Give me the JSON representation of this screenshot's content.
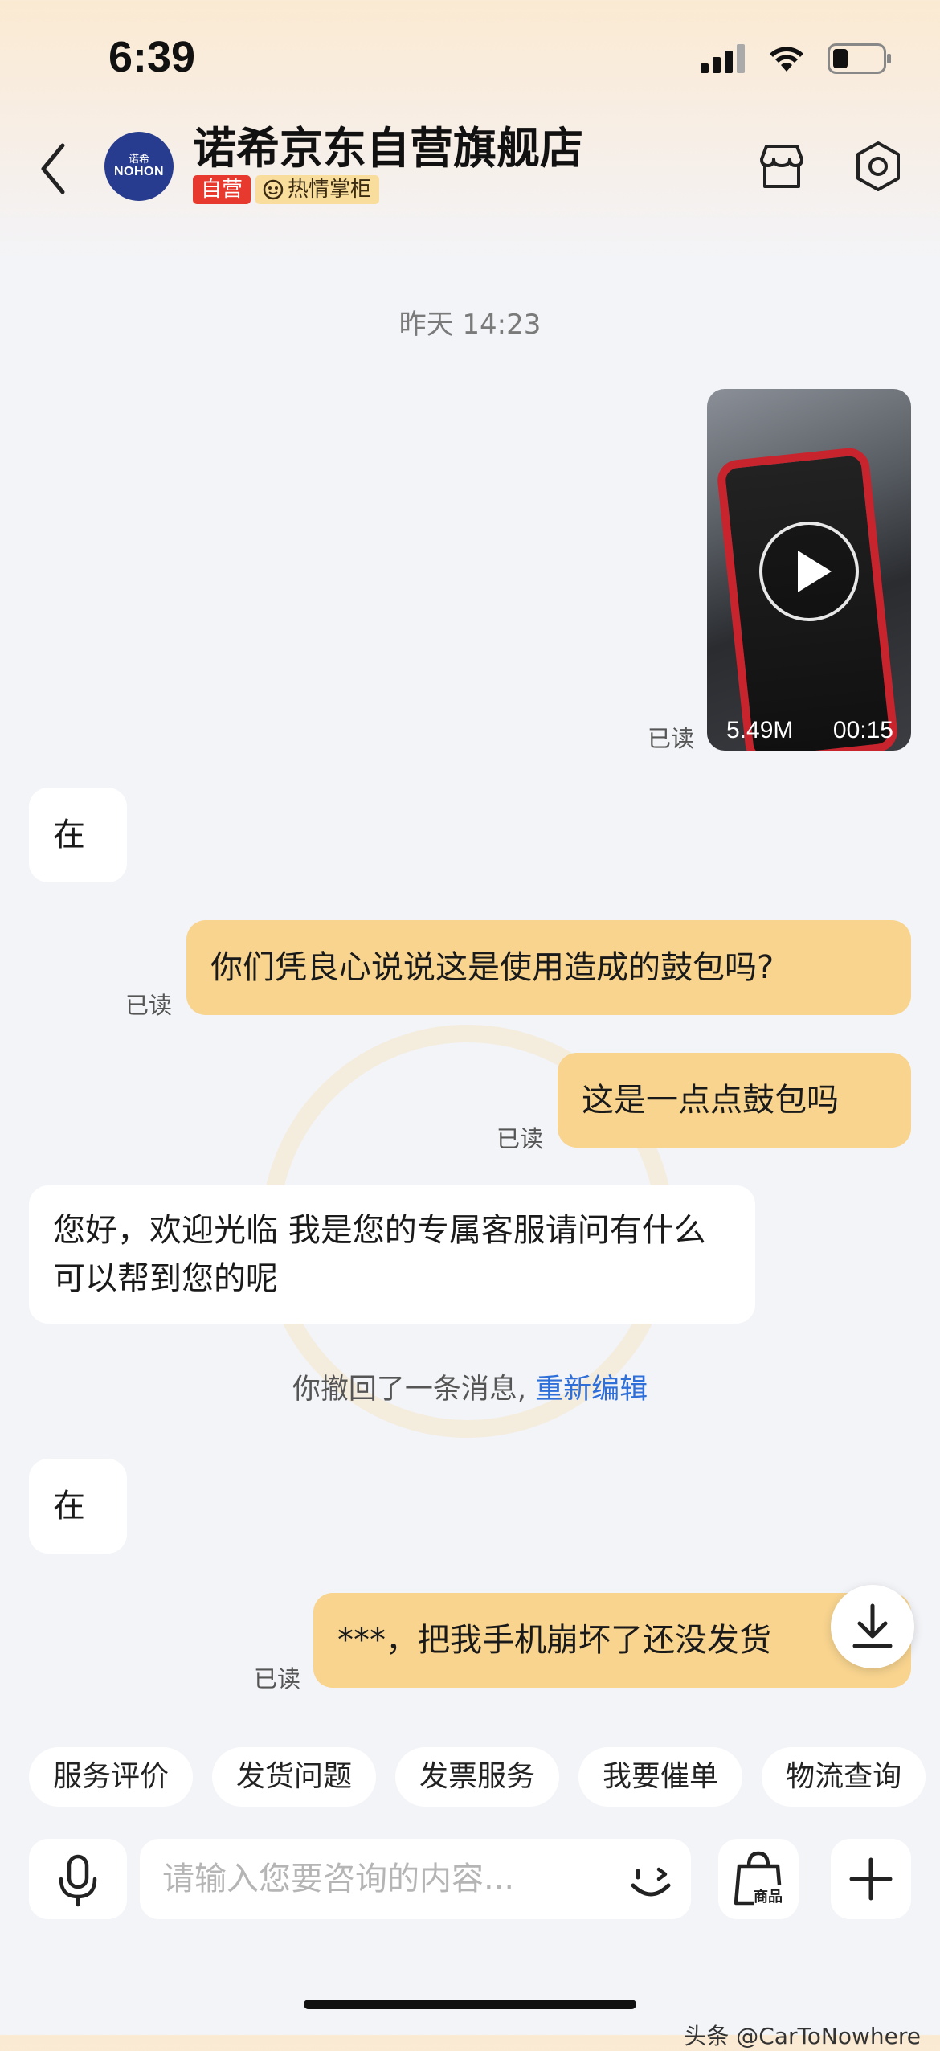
{
  "status_bar": {
    "time": "6:39"
  },
  "header": {
    "shop_name": "诺希京东自营旗舰店",
    "avatar_brand_top": "诺希",
    "avatar_brand": "NOHON",
    "badge_self": "自营",
    "badge_hot": "热情掌柜"
  },
  "chat": {
    "timestamp": "昨天 14:23",
    "video": {
      "size": "5.49M",
      "duration": "00:15",
      "read": "已读"
    },
    "msg1": "在",
    "msg2": {
      "text": "你们凭良心说说这是使用造成的鼓包吗?",
      "read": "已读"
    },
    "msg3": {
      "text": "这是一点点鼓包吗",
      "read": "已读"
    },
    "msg4": "您好，欢迎光临 我是您的专属客服请问有什么可以帮到您的呢",
    "recall_text": "你撤回了一条消息,",
    "recall_link": "重新编辑",
    "msg5": "在",
    "msg6": {
      "text": "***，把我手机崩坏了还没发货",
      "read": "已读"
    }
  },
  "quick_chips": [
    "服务评价",
    "发货问题",
    "发票服务",
    "我要催单",
    "物流查询"
  ],
  "input": {
    "placeholder": "请输入您要咨询的内容...",
    "goods_label": "商品"
  },
  "credit": "头条 @CarToNowhere",
  "colors": {
    "out_bubble": "#f8d48f",
    "link": "#2f6fd8",
    "badge_red": "#e8392f",
    "badge_gold": "#f9dd9c"
  }
}
